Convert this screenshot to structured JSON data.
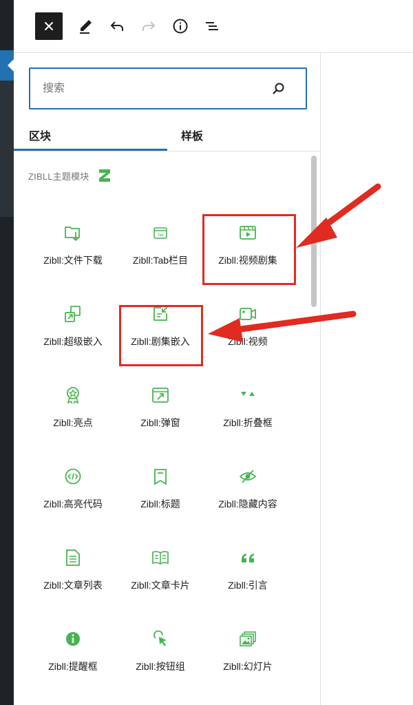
{
  "toolbar": {
    "close_icon": "close-icon",
    "tools_icon": "pencil-icon",
    "undo_icon": "undo-icon",
    "redo_icon": "redo-icon",
    "details_icon": "info-icon",
    "outline_icon": "list-view-icon"
  },
  "search": {
    "placeholder": "搜索",
    "value": ""
  },
  "tabs": [
    {
      "label": "区块",
      "active": true
    },
    {
      "label": "样板",
      "active": false
    }
  ],
  "category": {
    "title": "ZIBLL主题模块",
    "logo": "zibll-logo"
  },
  "blocks": [
    {
      "label": "Zibll:文件下载",
      "icon": "folder-download-icon"
    },
    {
      "label": "Zibll:Tab栏目",
      "icon": "tab-icon"
    },
    {
      "label": "Zibll:视频剧集",
      "icon": "video-series-icon"
    },
    {
      "label": "Zibll:超级嵌入",
      "icon": "super-embed-icon"
    },
    {
      "label": "Zibll:剧集嵌入",
      "icon": "series-embed-icon"
    },
    {
      "label": "Zibll:视频",
      "icon": "video-camera-icon"
    },
    {
      "label": "Zibll:亮点",
      "icon": "award-icon"
    },
    {
      "label": "Zibll:弹窗",
      "icon": "popup-icon"
    },
    {
      "label": "Zibll:折叠框",
      "icon": "collapse-icon"
    },
    {
      "label": "Zibll:高亮代码",
      "icon": "code-icon"
    },
    {
      "label": "Zibll:标题",
      "icon": "title-icon"
    },
    {
      "label": "Zibll:隐藏内容",
      "icon": "hidden-eye-icon"
    },
    {
      "label": "Zibll:文章列表",
      "icon": "article-list-icon"
    },
    {
      "label": "Zibll:文章卡片",
      "icon": "article-card-icon"
    },
    {
      "label": "Zibll:引言",
      "icon": "quote-icon"
    },
    {
      "label": "Zibll:提醒框",
      "icon": "info-alert-icon"
    },
    {
      "label": "Zibll:按钮组",
      "icon": "cursor-click-icon"
    },
    {
      "label": "Zibll:幻灯片",
      "icon": "slides-icon"
    }
  ],
  "colors": {
    "accent": "#2271b1",
    "icon_green": "#46b450",
    "annotation_red": "#e02b20",
    "dark": "#1e1e1e"
  }
}
